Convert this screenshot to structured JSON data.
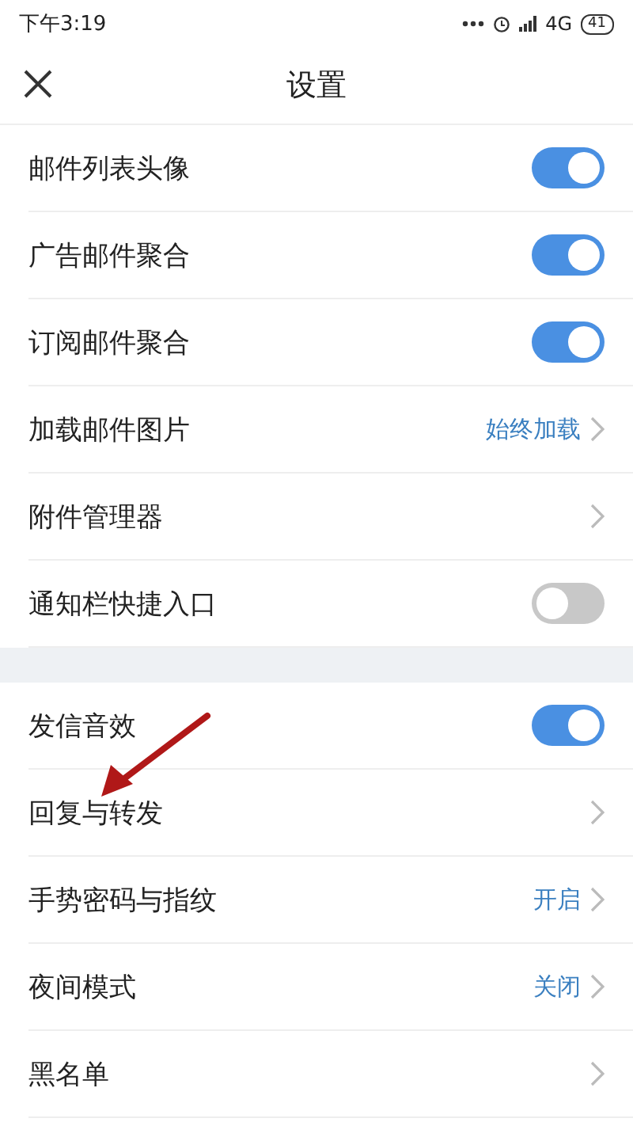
{
  "status_bar": {
    "time": "下午3:19",
    "network": "4G",
    "battery": "41"
  },
  "header": {
    "title": "设置"
  },
  "sections": [
    {
      "rows": [
        {
          "label": "邮件列表头像",
          "kind": "toggle",
          "on": true
        },
        {
          "label": "广告邮件聚合",
          "kind": "toggle",
          "on": true
        },
        {
          "label": "订阅邮件聚合",
          "kind": "toggle",
          "on": true
        },
        {
          "label": "加载邮件图片",
          "kind": "link",
          "value": "始终加载"
        },
        {
          "label": "附件管理器",
          "kind": "link"
        },
        {
          "label": "通知栏快捷入口",
          "kind": "toggle",
          "on": false
        }
      ]
    },
    {
      "rows": [
        {
          "label": "发信音效",
          "kind": "toggle",
          "on": true
        },
        {
          "label": "回复与转发",
          "kind": "link"
        },
        {
          "label": "手势密码与指纹",
          "kind": "link",
          "value": "开启"
        },
        {
          "label": "夜间模式",
          "kind": "link",
          "value": "关闭"
        },
        {
          "label": "黑名单",
          "kind": "link"
        }
      ]
    }
  ]
}
